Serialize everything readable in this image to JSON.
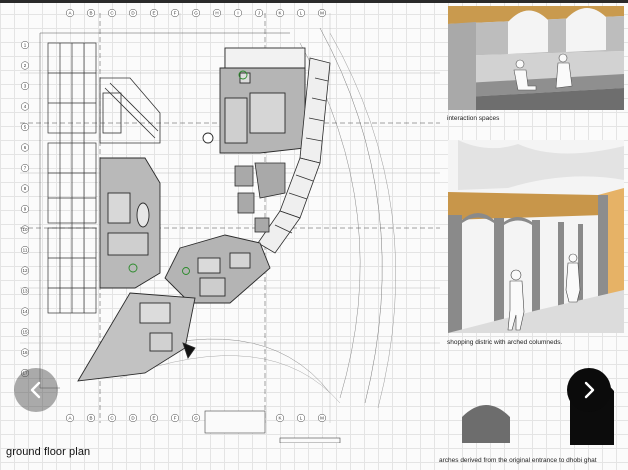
{
  "plan": {
    "title": "ground floor plan",
    "column_letters": [
      "A",
      "B",
      "C",
      "D",
      "E",
      "F",
      "G",
      "H",
      "I",
      "J",
      "K",
      "L",
      "M"
    ],
    "row_numbers": [
      "1",
      "2",
      "3",
      "4",
      "5",
      "6",
      "7",
      "8",
      "9",
      "10",
      "11",
      "12",
      "13",
      "14",
      "15",
      "16",
      "17"
    ]
  },
  "panels": {
    "interaction_caption": "interaction spaces",
    "shopping_caption": "shopping distric with arched columneds.",
    "arches_caption": "arches derived from the original entrance to dhobi ghat"
  },
  "navigation": {
    "prev_icon": "chevron-left-icon",
    "next_icon": "chevron-right-icon"
  },
  "colors": {
    "grid_line": "#e4e4e4",
    "wall": "#3a3a3a",
    "shaded_zone": "#b8b8b8",
    "roof_wood": "#c99a4e",
    "arch_grey": "#6d6d6d",
    "arch_black": "#0c0c0c"
  }
}
